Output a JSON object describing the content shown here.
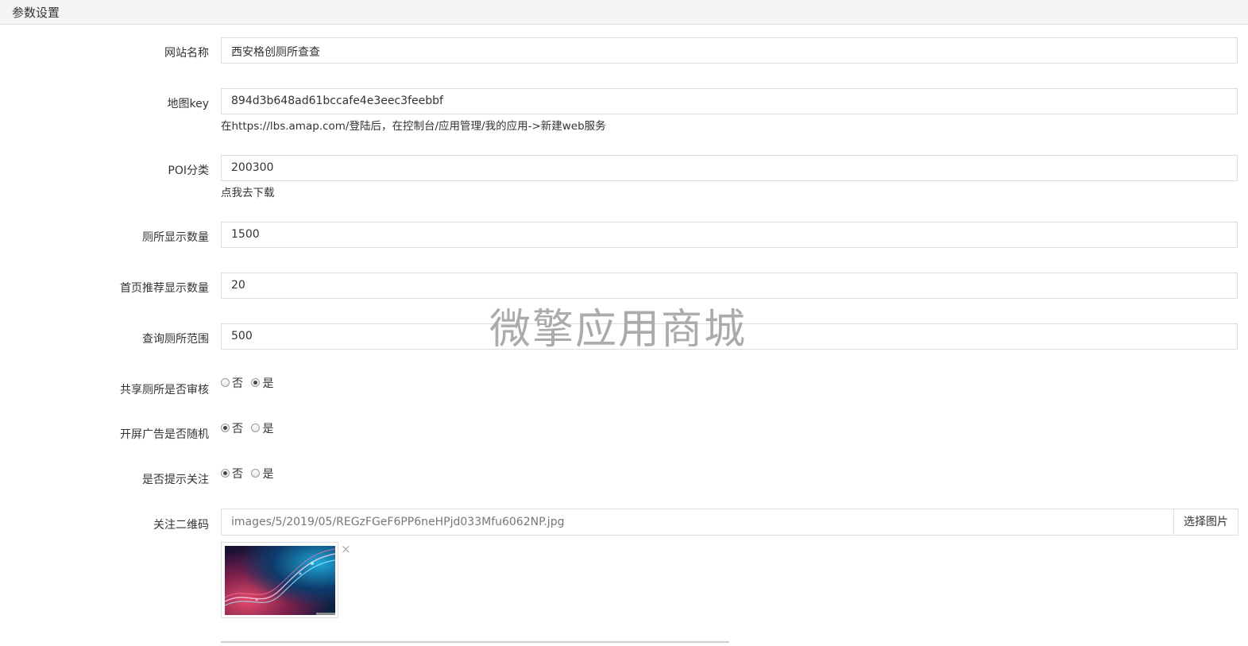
{
  "panel": {
    "title": "参数设置"
  },
  "fields": {
    "site_name": {
      "label": "网站名称",
      "value": "西安格创厕所查查"
    },
    "map_key": {
      "label": "地图key",
      "value": "894d3b648ad61bccafe4e3eec3feebbf",
      "help": "在https://lbs.amap.com/登陆后，在控制台/应用管理/我的应用->新建web服务"
    },
    "poi": {
      "label": "POI分类",
      "value": "200300",
      "help": "点我去下载"
    },
    "toilet_count": {
      "label": "厕所显示数量",
      "value": "1500"
    },
    "home_count": {
      "label": "首页推荐显示数量",
      "value": "20"
    },
    "range": {
      "label": "查询厕所范围",
      "value": "500"
    }
  },
  "radios": {
    "share_audit": {
      "label": "共享厕所是否审核",
      "no": "否",
      "yes": "是",
      "selected": "yes"
    },
    "ad_random": {
      "label": "开屏广告是否随机",
      "no": "否",
      "yes": "是",
      "selected": "no"
    },
    "follow_tip": {
      "label": "是否提示关注",
      "no": "否",
      "yes": "是",
      "selected": "no"
    }
  },
  "qrcode": {
    "label": "关注二维码",
    "path": "images/5/2019/05/REGzFGeF6PP6neHPjd033Mfu6062NP.jpg",
    "button": "选择图片",
    "remove": "×"
  },
  "watermark": "微擎应用商城"
}
